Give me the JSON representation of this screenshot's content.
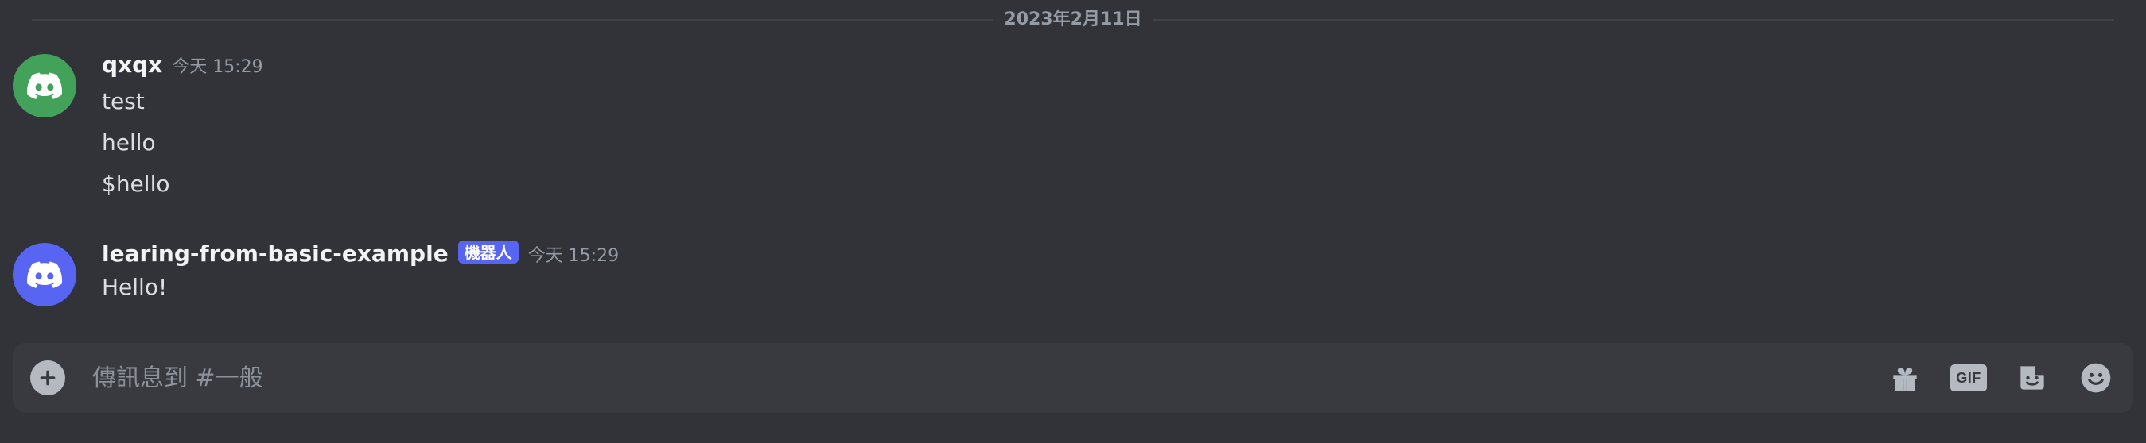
{
  "date_divider": "2023年2月11日",
  "messages": [
    {
      "username": "qxqx",
      "timestamp": "今天 15:29",
      "avatar_icon": "discord-logo-icon",
      "avatar_color": "#43a25a",
      "lines": [
        "test",
        "hello",
        "$hello"
      ]
    },
    {
      "username": "learing-from-basic-example",
      "bot_tag": "機器人",
      "timestamp": "今天 15:29",
      "avatar_icon": "discord-logo-icon",
      "avatar_color": "#5865f2",
      "lines": [
        "Hello!"
      ]
    }
  ],
  "composer": {
    "placeholder": "傳訊息到 #一般",
    "value": "",
    "add_icon": "plus-circle-icon",
    "tools": [
      {
        "icon": "gift-icon"
      },
      {
        "icon": "gif-icon",
        "label": "GIF"
      },
      {
        "icon": "sticker-icon"
      },
      {
        "icon": "emoji-icon"
      }
    ]
  },
  "colors": {
    "background": "#313338",
    "composer_background": "#383a40",
    "bot_tag": "#5865f2",
    "text": "#dbdee1",
    "muted": "#949ba4"
  }
}
